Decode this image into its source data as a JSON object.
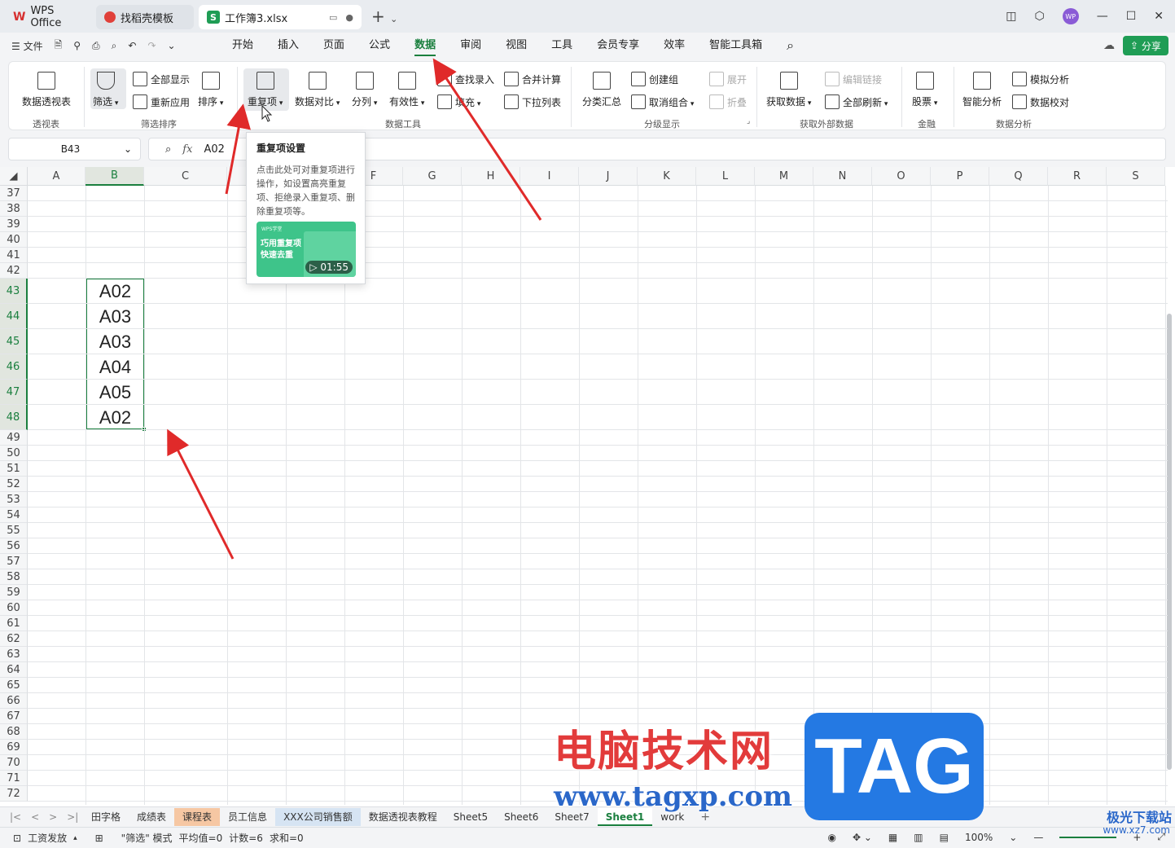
{
  "titlebar": {
    "tabs": [
      {
        "label": "WPS Office"
      },
      {
        "label": "找稻壳模板"
      },
      {
        "label": "工作簿3.xlsx"
      }
    ],
    "avatar_text": "WP"
  },
  "menubar": {
    "file_label": "文件",
    "items": [
      "开始",
      "插入",
      "页面",
      "公式",
      "数据",
      "审阅",
      "视图",
      "工具",
      "会员专享",
      "效率",
      "智能工具箱"
    ],
    "active": "数据",
    "share_label": "分享"
  },
  "ribbon": {
    "pivot": "数据透视表",
    "filter": "筛选",
    "show_all": "全部显示",
    "reapply": "重新应用",
    "sort": "排序",
    "duplicate": "重复项",
    "compare": "数据对比",
    "split": "分列",
    "validity": "有效性",
    "lookup_entry": "查找录入",
    "fill": "填充",
    "merge_calc": "合并计算",
    "dropdown_list": "下拉列表",
    "subtotal": "分类汇总",
    "create_group": "创建组",
    "ungroup": "取消组合",
    "expand": "展开",
    "collapse": "折叠",
    "get_data": "获取数据",
    "edit_links": "编辑链接",
    "refresh_all": "全部刷新",
    "stock": "股票",
    "smart_analysis": "智能分析",
    "what_if": "模拟分析",
    "data_check": "数据校对",
    "groups": {
      "pivot": "透视表",
      "filter_sort": "筛选排序",
      "data_tools": "数据工具",
      "outline": "分级显示",
      "external": "获取外部数据",
      "finance": "金融",
      "analysis": "数据分析"
    }
  },
  "formula": {
    "cell_ref": "B43",
    "fx": "fx",
    "value": "A02"
  },
  "grid": {
    "columns": [
      "A",
      "B",
      "C",
      "D",
      "E",
      "F",
      "G",
      "H",
      "I",
      "J",
      "K",
      "L",
      "M",
      "N",
      "O",
      "P",
      "Q",
      "R",
      "S"
    ],
    "selected_column": "B",
    "rows": [
      "37",
      "38",
      "39",
      "40",
      "41",
      "42",
      "43",
      "44",
      "45",
      "46",
      "47",
      "48",
      "49",
      "50",
      "51",
      "52",
      "53",
      "54",
      "55",
      "56",
      "57",
      "58",
      "59",
      "60",
      "61",
      "62",
      "63",
      "64",
      "65",
      "66",
      "67",
      "68",
      "69",
      "70",
      "71",
      "72"
    ],
    "values": [
      {
        "row": "43",
        "b": "A02"
      },
      {
        "row": "44",
        "b": "A03"
      },
      {
        "row": "45",
        "b": "A03"
      },
      {
        "row": "46",
        "b": "A04"
      },
      {
        "row": "47",
        "b": "A05"
      },
      {
        "row": "48",
        "b": "A02"
      }
    ]
  },
  "tooltip": {
    "title": "重复项设置",
    "body": "点击此处可对重复项进行操作，如设置高亮重复项、拒绝录入重复项、删除重复项等。",
    "video_brand": "WPS学堂",
    "video_title_1": "巧用重复项",
    "video_title_2": "快速去重",
    "video_duration": "01:55"
  },
  "sheets": [
    {
      "name": "田字格",
      "style": ""
    },
    {
      "name": "成绩表",
      "style": ""
    },
    {
      "name": "课程表",
      "style": "orange"
    },
    {
      "name": "员工信息",
      "style": ""
    },
    {
      "name": "XXX公司销售额",
      "style": "blue"
    },
    {
      "name": "数据透视表教程",
      "style": ""
    },
    {
      "name": "Sheet5",
      "style": ""
    },
    {
      "name": "Sheet6",
      "style": ""
    },
    {
      "name": "Sheet7",
      "style": ""
    },
    {
      "name": "Sheet1",
      "style": "active"
    },
    {
      "name": "work",
      "style": ""
    }
  ],
  "status": {
    "payroll": "工资发放",
    "mode": "\"筛选\" 模式",
    "avg": "平均值=0",
    "count": "计数=6",
    "sum": "求和=0",
    "zoom": "100%"
  },
  "watermark": {
    "cn": "电脑技术网",
    "url": "www.tagxp.com",
    "tag": "TAG",
    "corner": "极光下载站",
    "corner_url": "www.xz7.com"
  }
}
